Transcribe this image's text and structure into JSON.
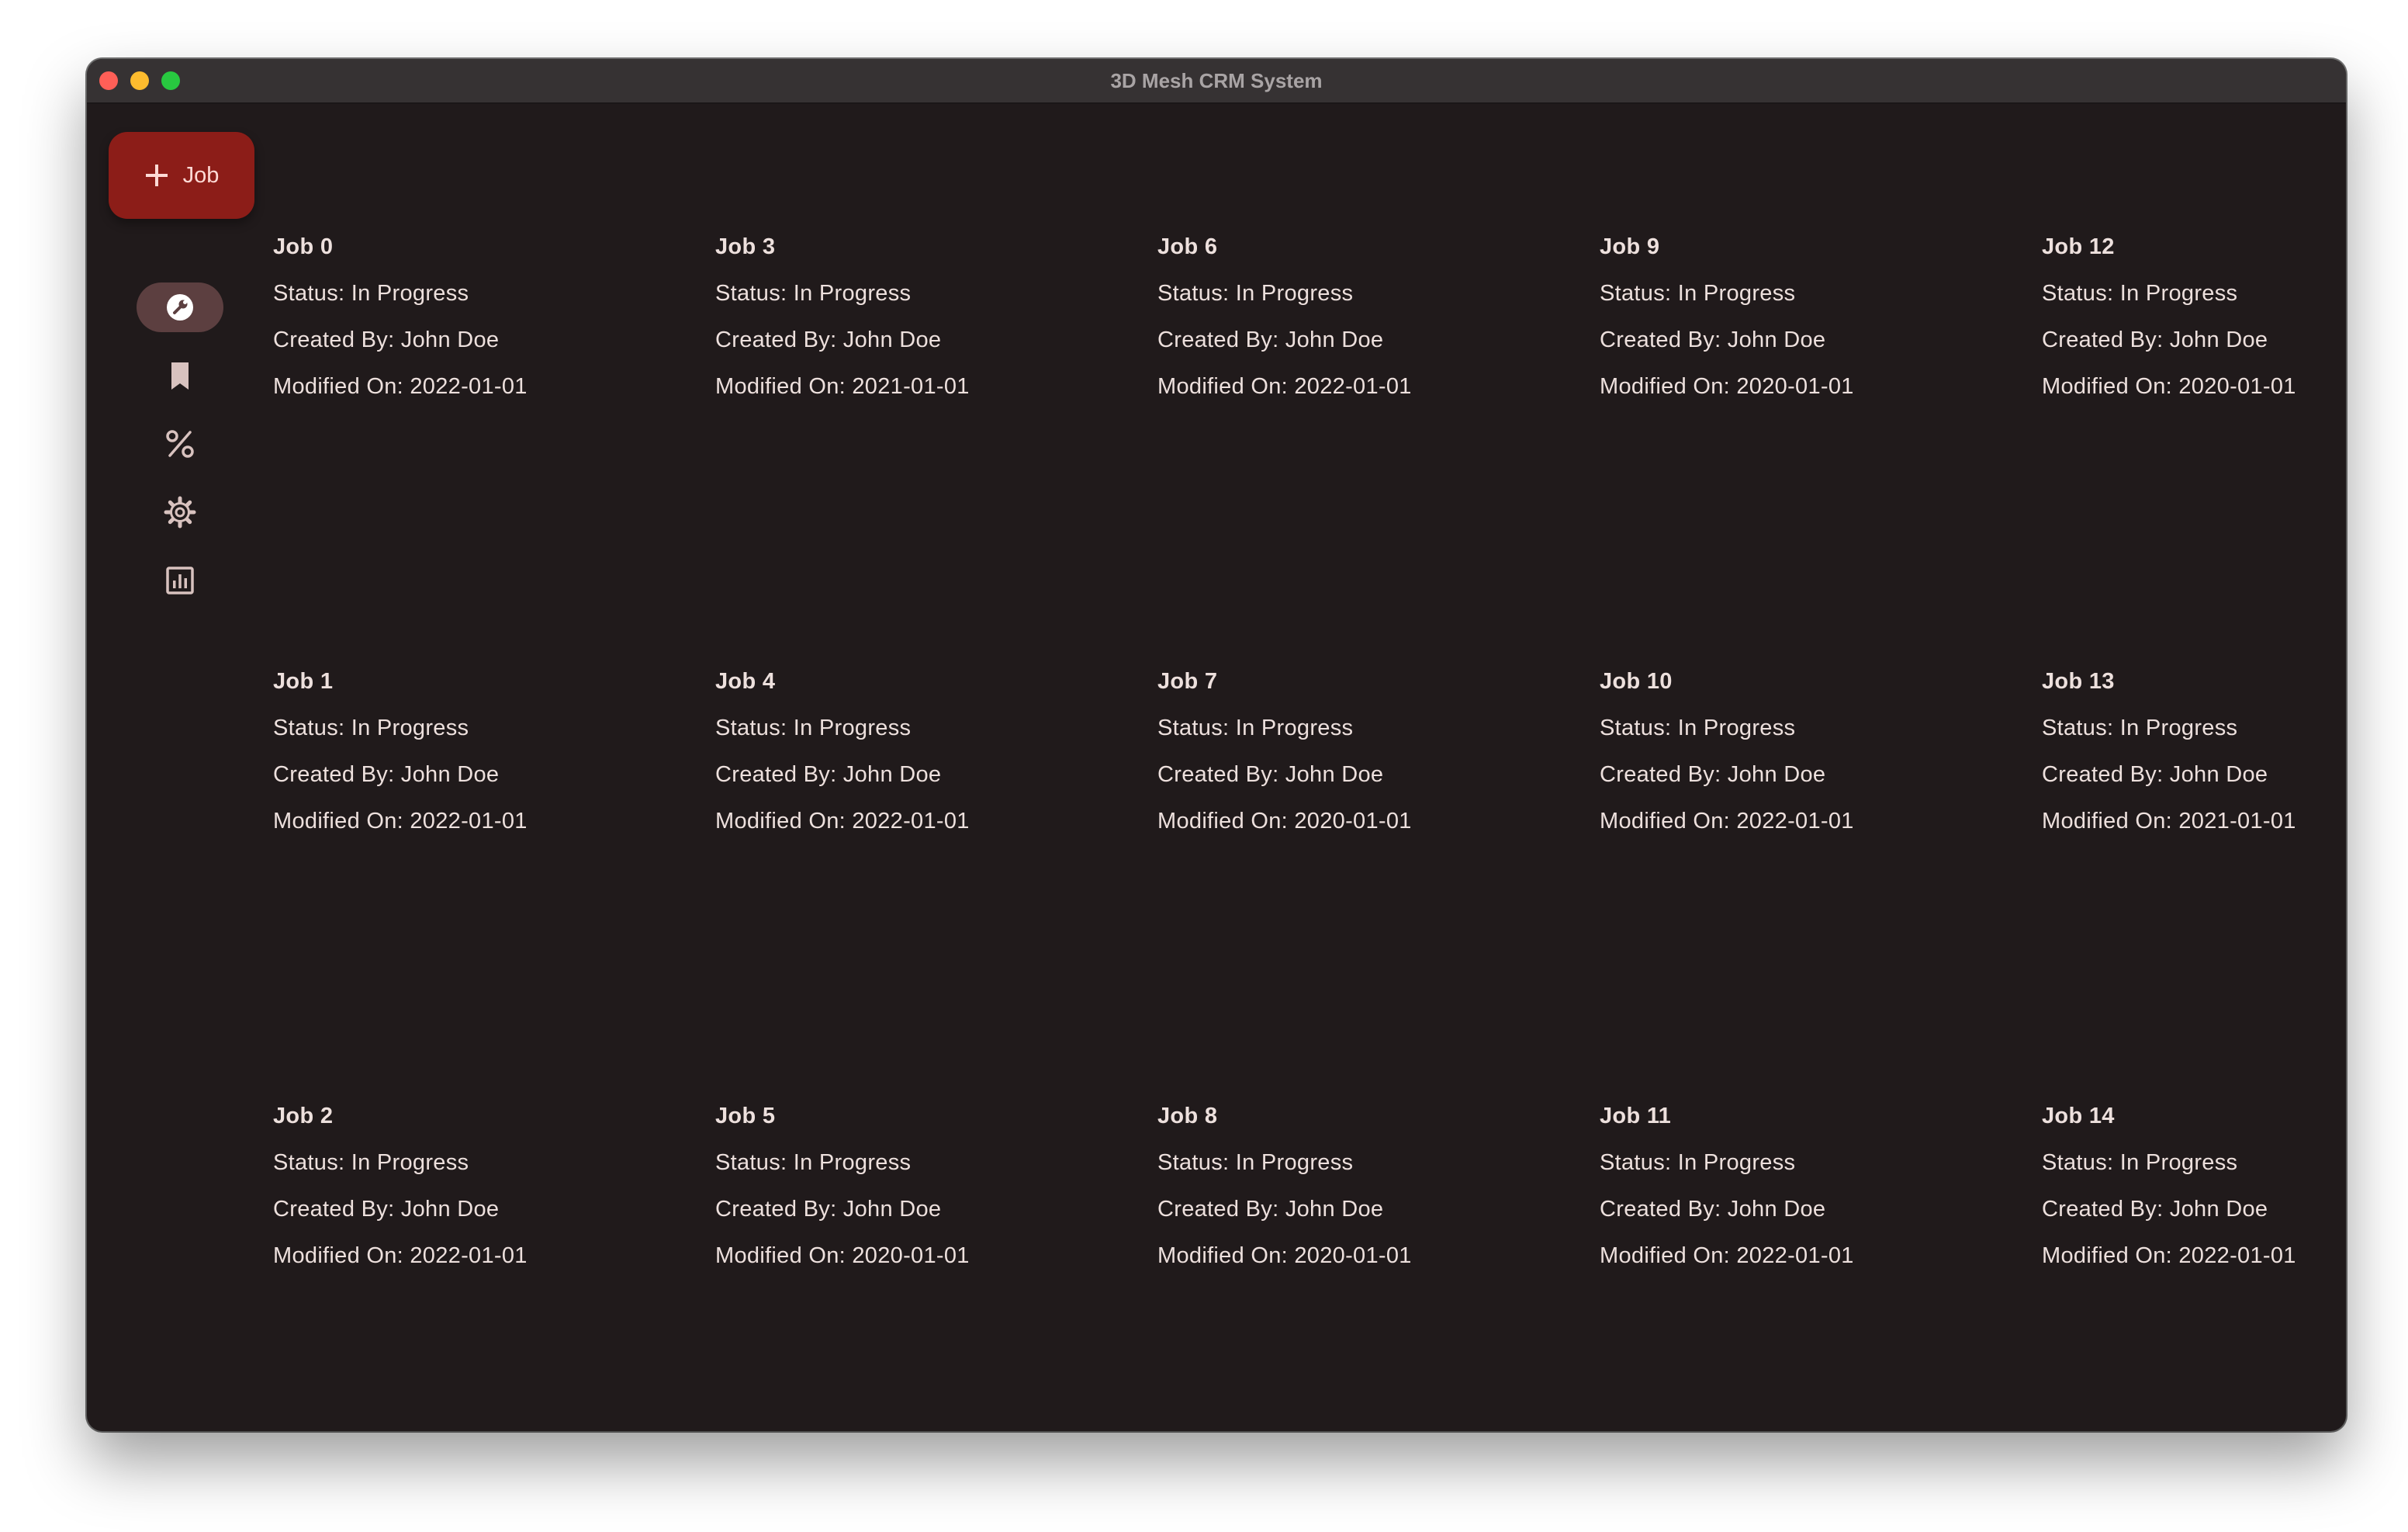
{
  "window": {
    "title": "3D Mesh CRM System"
  },
  "fab": {
    "label": "Job",
    "icon": "plus-icon"
  },
  "rail": {
    "items": [
      {
        "icon": "wrench-icon",
        "active": true
      },
      {
        "icon": "bookmark-icon",
        "active": false
      },
      {
        "icon": "percent-icon",
        "active": false
      },
      {
        "icon": "gear-icon",
        "active": false
      },
      {
        "icon": "chart-icon",
        "active": false
      }
    ]
  },
  "colors": {
    "background": "#201a1b",
    "fab": "#8c1d18",
    "rail_active": "#5c3f40",
    "text": "#ede0dd"
  },
  "jobs": [
    {
      "title": "Job 0",
      "status": "Status: In Progress",
      "created": "Created By: John Doe",
      "modified": "Modified On: 2022-01-01"
    },
    {
      "title": "Job 1",
      "status": "Status: In Progress",
      "created": "Created By: John Doe",
      "modified": "Modified On: 2022-01-01"
    },
    {
      "title": "Job 2",
      "status": "Status: In Progress",
      "created": "Created By: John Doe",
      "modified": "Modified On: 2022-01-01"
    },
    {
      "title": "Job 3",
      "status": "Status: In Progress",
      "created": "Created By: John Doe",
      "modified": "Modified On: 2021-01-01"
    },
    {
      "title": "Job 4",
      "status": "Status: In Progress",
      "created": "Created By: John Doe",
      "modified": "Modified On: 2022-01-01"
    },
    {
      "title": "Job 5",
      "status": "Status: In Progress",
      "created": "Created By: John Doe",
      "modified": "Modified On: 2020-01-01"
    },
    {
      "title": "Job 6",
      "status": "Status: In Progress",
      "created": "Created By: John Doe",
      "modified": "Modified On: 2022-01-01"
    },
    {
      "title": "Job 7",
      "status": "Status: In Progress",
      "created": "Created By: John Doe",
      "modified": "Modified On: 2020-01-01"
    },
    {
      "title": "Job 8",
      "status": "Status: In Progress",
      "created": "Created By: John Doe",
      "modified": "Modified On: 2020-01-01"
    },
    {
      "title": "Job 9",
      "status": "Status: In Progress",
      "created": "Created By: John Doe",
      "modified": "Modified On: 2020-01-01"
    },
    {
      "title": "Job 10",
      "status": "Status: In Progress",
      "created": "Created By: John Doe",
      "modified": "Modified On: 2022-01-01"
    },
    {
      "title": "Job 11",
      "status": "Status: In Progress",
      "created": "Created By: John Doe",
      "modified": "Modified On: 2022-01-01"
    },
    {
      "title": "Job 12",
      "status": "Status: In Progress",
      "created": "Created By: John Doe",
      "modified": "Modified On: 2020-01-01"
    },
    {
      "title": "Job 13",
      "status": "Status: In Progress",
      "created": "Created By: John Doe",
      "modified": "Modified On: 2021-01-01"
    },
    {
      "title": "Job 14",
      "status": "Status: In Progress",
      "created": "Created By: John Doe",
      "modified": "Modified On: 2022-01-01"
    }
  ]
}
